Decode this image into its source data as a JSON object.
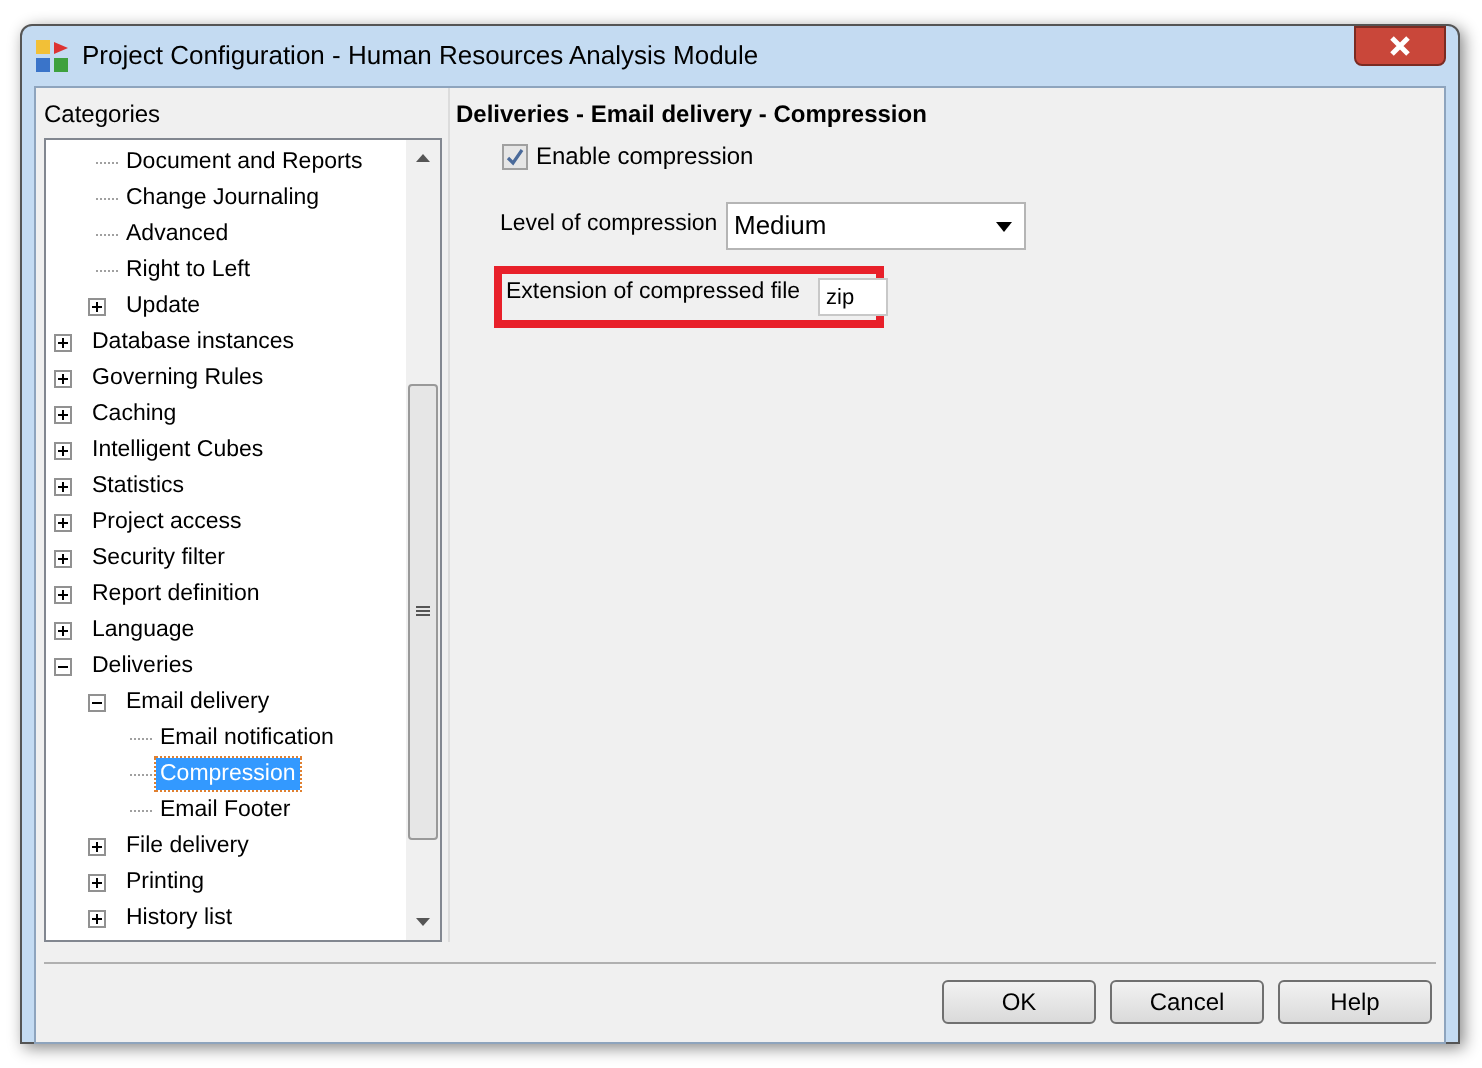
{
  "window": {
    "title": "Project Configuration - Human Resources Analysis Module"
  },
  "categories": {
    "label": "Categories",
    "orphan_items": [
      {
        "label": "Document and Reports",
        "selected": false
      },
      {
        "label": "Change Journaling",
        "selected": false
      },
      {
        "label": "Advanced",
        "selected": false
      },
      {
        "label": "Right to Left",
        "selected": false
      },
      {
        "label": "Update",
        "selected": false,
        "expanded": false
      }
    ],
    "items": [
      {
        "label": "Database instances",
        "selected": false,
        "expanded": false
      },
      {
        "label": "Governing Rules",
        "selected": false,
        "expanded": false
      },
      {
        "label": "Caching",
        "selected": false,
        "expanded": false
      },
      {
        "label": "Intelligent Cubes",
        "selected": false,
        "expanded": false
      },
      {
        "label": "Statistics",
        "selected": false,
        "expanded": false
      },
      {
        "label": "Project access",
        "selected": false,
        "expanded": false
      },
      {
        "label": "Security filter",
        "selected": false,
        "expanded": false
      },
      {
        "label": "Report definition",
        "selected": false,
        "expanded": false
      },
      {
        "label": "Language",
        "selected": false,
        "expanded": false
      },
      {
        "label": "Deliveries",
        "selected": false,
        "expanded": true,
        "children": [
          {
            "label": "Email delivery",
            "selected": false,
            "expanded": true,
            "children": [
              {
                "label": "Email notification",
                "selected": false
              },
              {
                "label": "Compression",
                "selected": true
              },
              {
                "label": "Email Footer",
                "selected": false
              }
            ]
          },
          {
            "label": "File delivery",
            "selected": false,
            "expanded": false
          },
          {
            "label": "Printing",
            "selected": false,
            "expanded": false
          },
          {
            "label": "History list",
            "selected": false,
            "expanded": false
          }
        ]
      }
    ]
  },
  "panel": {
    "heading": "Deliveries - Email delivery - Compression",
    "enable_compression": {
      "label": "Enable compression",
      "checked": true,
      "disabled": true
    },
    "level": {
      "label": "Level of compression",
      "value": "Medium"
    },
    "extension": {
      "label": "Extension of compressed file",
      "value": "zip",
      "highlighted": true
    }
  },
  "buttons": [
    "OK",
    "Cancel",
    "Help"
  ]
}
